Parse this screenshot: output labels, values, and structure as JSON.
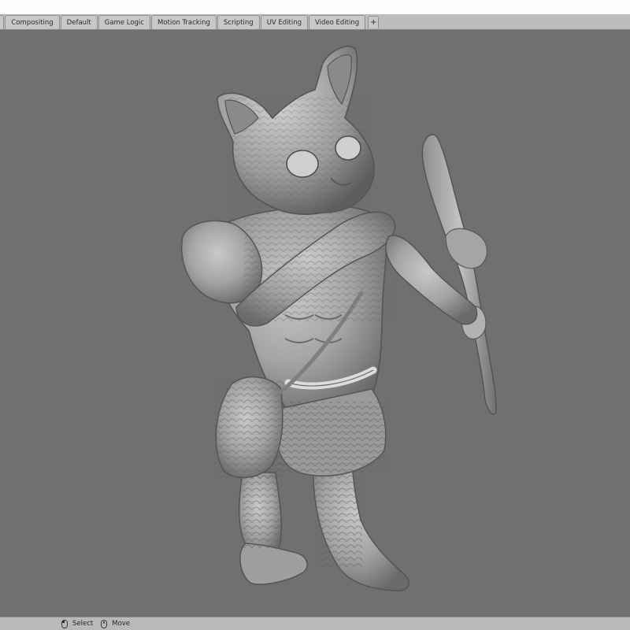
{
  "workspace_tabs": [
    {
      "label": "n",
      "state": "partially-visible"
    },
    {
      "label": "Compositing"
    },
    {
      "label": "Default"
    },
    {
      "label": "Game Logic"
    },
    {
      "label": "Motion Tracking"
    },
    {
      "label": "Scripting"
    },
    {
      "label": "UV Editing"
    },
    {
      "label": "Video Editing"
    }
  ],
  "add_tab_label": "+",
  "viewport": {
    "subject": "sculpted cat warrior holding a bow",
    "background_color": "#707070",
    "model_color": "#a9a9a9"
  },
  "status_bar": {
    "hints": [
      {
        "icon": "mouse-left-icon",
        "label": "Select"
      },
      {
        "icon": "mouse-middle-icon",
        "label": "Move"
      }
    ]
  },
  "colors": {
    "tabbar_bg": "#bdbdbd",
    "tab_bg": "#c8c8c8",
    "statusbar_bg": "#b9b9b9",
    "top_strip": "#fcfcfc"
  }
}
